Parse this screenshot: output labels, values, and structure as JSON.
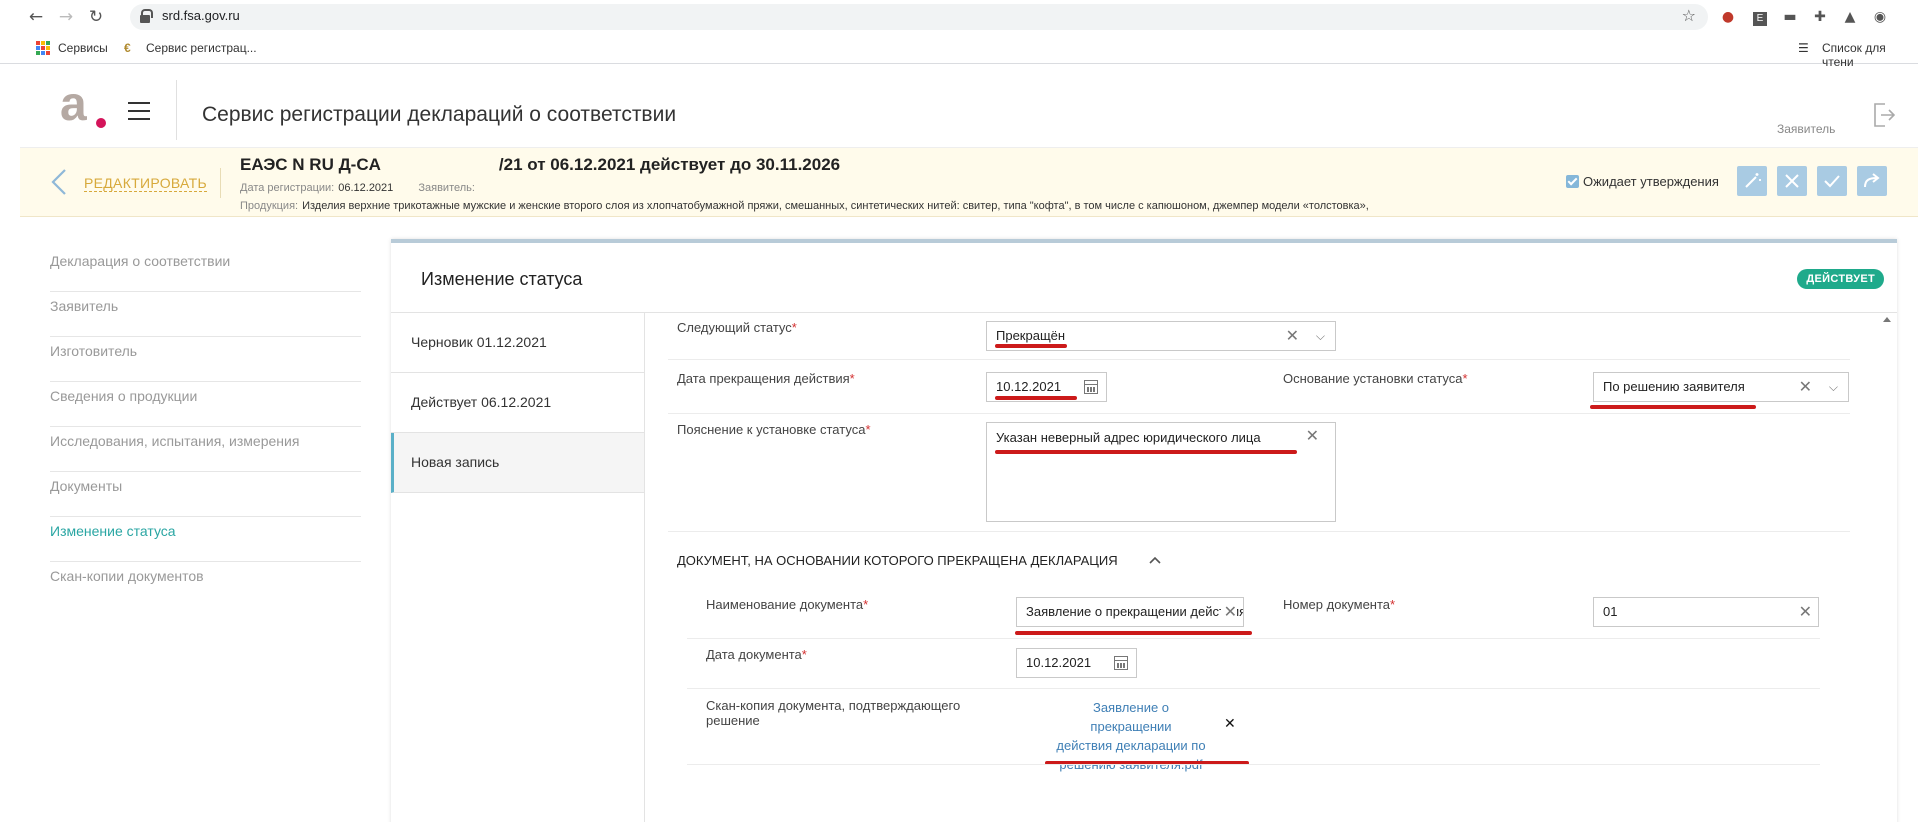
{
  "browser": {
    "url": "srd.fsa.gov.ru",
    "bookmarks": [
      {
        "label": "Сервисы"
      },
      {
        "label": "Сервис регистрац..."
      }
    ],
    "reading_list": "Список для чтени"
  },
  "header": {
    "title": "Сервис регистрации деклараций о соответствии",
    "user_role": "Заявитель"
  },
  "banner": {
    "edit_label": "РЕДАКТИРОВАТЬ",
    "declaration_prefix": "ЕАЭС N RU Д-CA",
    "declaration_suffix": "/21 от 06.12.2021 действует до 30.11.2026",
    "reg_date_label": "Дата регистрации:",
    "reg_date_value": "06.12.2021",
    "applicant_label": "Заявитель:",
    "product_label": "Продукция:",
    "product_value": "Изделия верхние трикотажные мужские и женские второго слоя из хлопчатобумажной пряжи, смешанных, синтетических нитей: свитер, типа \"кофта\", в том числе с капюшоном, джемпер модели «толстовка»,",
    "awaiting_label": "Ожидает утверждения",
    "awaiting_checked": true
  },
  "leftnav": {
    "items": [
      {
        "label": "Декларация о соответствии",
        "active": false
      },
      {
        "label": "Заявитель",
        "active": false
      },
      {
        "label": "Изготовитель",
        "active": false
      },
      {
        "label": "Сведения о продукции",
        "active": false
      },
      {
        "label": "Исследования, испытания, измерения",
        "active": false
      },
      {
        "label": "Документы",
        "active": false
      },
      {
        "label": "Изменение статуса",
        "active": true
      },
      {
        "label": "Скан-копии документов",
        "active": false
      }
    ]
  },
  "panel": {
    "title": "Изменение статуса",
    "status_badge": "ДЕЙСТВУЕТ",
    "status_color": "#1faa8b",
    "versions": [
      {
        "label": "Черновик 01.12.2021",
        "active": false
      },
      {
        "label": "Действует 06.12.2021",
        "active": false
      },
      {
        "label": "Новая запись",
        "active": true
      }
    ]
  },
  "form": {
    "next_status": {
      "label": "Следующий статус",
      "value": "Прекращён"
    },
    "end_date": {
      "label": "Дата прекращения действия",
      "value": "10.12.2021"
    },
    "status_basis": {
      "label": "Основание установки статуса",
      "value": "По решению заявителя"
    },
    "explanation": {
      "label": "Пояснение к установке статуса",
      "value": "Указан неверный адрес юридического лица"
    },
    "section_title": "ДОКУМЕНТ, НА ОСНОВАНИИ КОТОРОГО ПРЕКРАЩЕНА ДЕКЛАРАЦИЯ",
    "doc_name": {
      "label": "Наименование документа",
      "value": "Заявление о прекращении действия декларации"
    },
    "doc_number": {
      "label": "Номер документа",
      "value": "01"
    },
    "doc_date": {
      "label": "Дата документа",
      "value": "10.12.2021"
    },
    "scan": {
      "label_line1": "Скан-копия документа, подтверждающего",
      "label_line2": "решение",
      "file_line1": "Заявление о прекращении",
      "file_line2": "действия декларации по",
      "file_line3": "решению заявителя.pdf"
    },
    "required_mark": "*"
  },
  "colors": {
    "accent_teal": "#2aa6a3",
    "edit_gold": "#d7a93b",
    "banner_bg": "#fffbeb",
    "action_button": "#a9cbe3",
    "link_blue": "#3f7fb5",
    "annotation_red": "#cc1a1a"
  }
}
